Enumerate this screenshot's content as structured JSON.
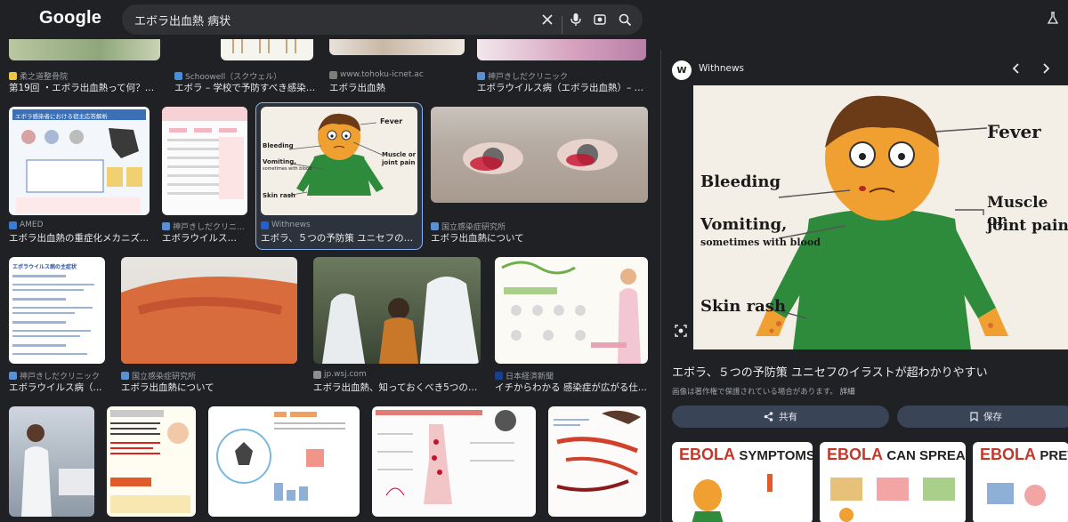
{
  "header": {
    "logo": "Google",
    "search_query": "エボラ出血熱 病状"
  },
  "results": [
    {
      "source": "柔之道整骨院",
      "title": "第19回 ・エボラ出血熱って何？｜ ..."
    },
    {
      "source": "Schoowell（スクウェル）",
      "title": "エボラ – 学校で予防すべき感染症..."
    },
    {
      "source": "www.tohoku-icnet.ac",
      "title": "エボラ出血熱"
    },
    {
      "source": "神戸きしだクリニック",
      "title": "エボラウイルス病（エボラ出血熱）– 感..."
    },
    {
      "source": "AMED",
      "title": "エボラ出血熱の重症化メカニズ..."
    },
    {
      "source": "神戸きしだクリニ...",
      "title": "エボラウイルス病..."
    },
    {
      "source": "Withnews",
      "title": "エボラ、５つの予防策 ユニセフのイ..."
    },
    {
      "source": "国立感染症研究所",
      "title": "エボラ出血熱について"
    },
    {
      "source": "神戸きしだクリニック",
      "title": "エボラウイルス病（..."
    },
    {
      "source": "国立感染症研究所",
      "title": "エボラ出血熱について"
    },
    {
      "source": "jp.wsj.com",
      "title": "エボラ出血熱、知っておくべき5つのこ..."
    },
    {
      "source": "日本経済新聞",
      "title": "イチからわかる 感染症が広がる仕..."
    }
  ],
  "thumb_texts": {
    "amed_header": "エボラ感染者における宿主応答解析",
    "kishida_header": "エボラウイルス病の主症状",
    "wsj_alt": "",
    "fever": "Fever",
    "bleeding": "Bleeding",
    "vomiting": "Vomiting,",
    "vomiting_sub": "sometimes with blood",
    "muscle": "Muscle or",
    "joint": "joint pain",
    "skin_rash": "Skin rash"
  },
  "panel": {
    "publisher_logo": "W",
    "publisher": "Withnews",
    "title": "エボラ、５つの予防策 ユニセフのイラストが超わかりやすい",
    "copyright": "画像は著作権で保護されている場合があります。",
    "copyright_link": "詳細",
    "share_label": "共有",
    "save_label": "保存",
    "related": [
      {
        "heading": "EBOLA",
        "sub": "SYMPTOMS"
      },
      {
        "heading": "EBOLA",
        "sub": "CAN SPREAD"
      },
      {
        "heading": "EBOLA",
        "sub": "PREV"
      }
    ]
  },
  "colors": {
    "background": "#202124",
    "search_bg": "#303134",
    "selected_border": "#8ab4f8",
    "button_bg": "#394457"
  }
}
